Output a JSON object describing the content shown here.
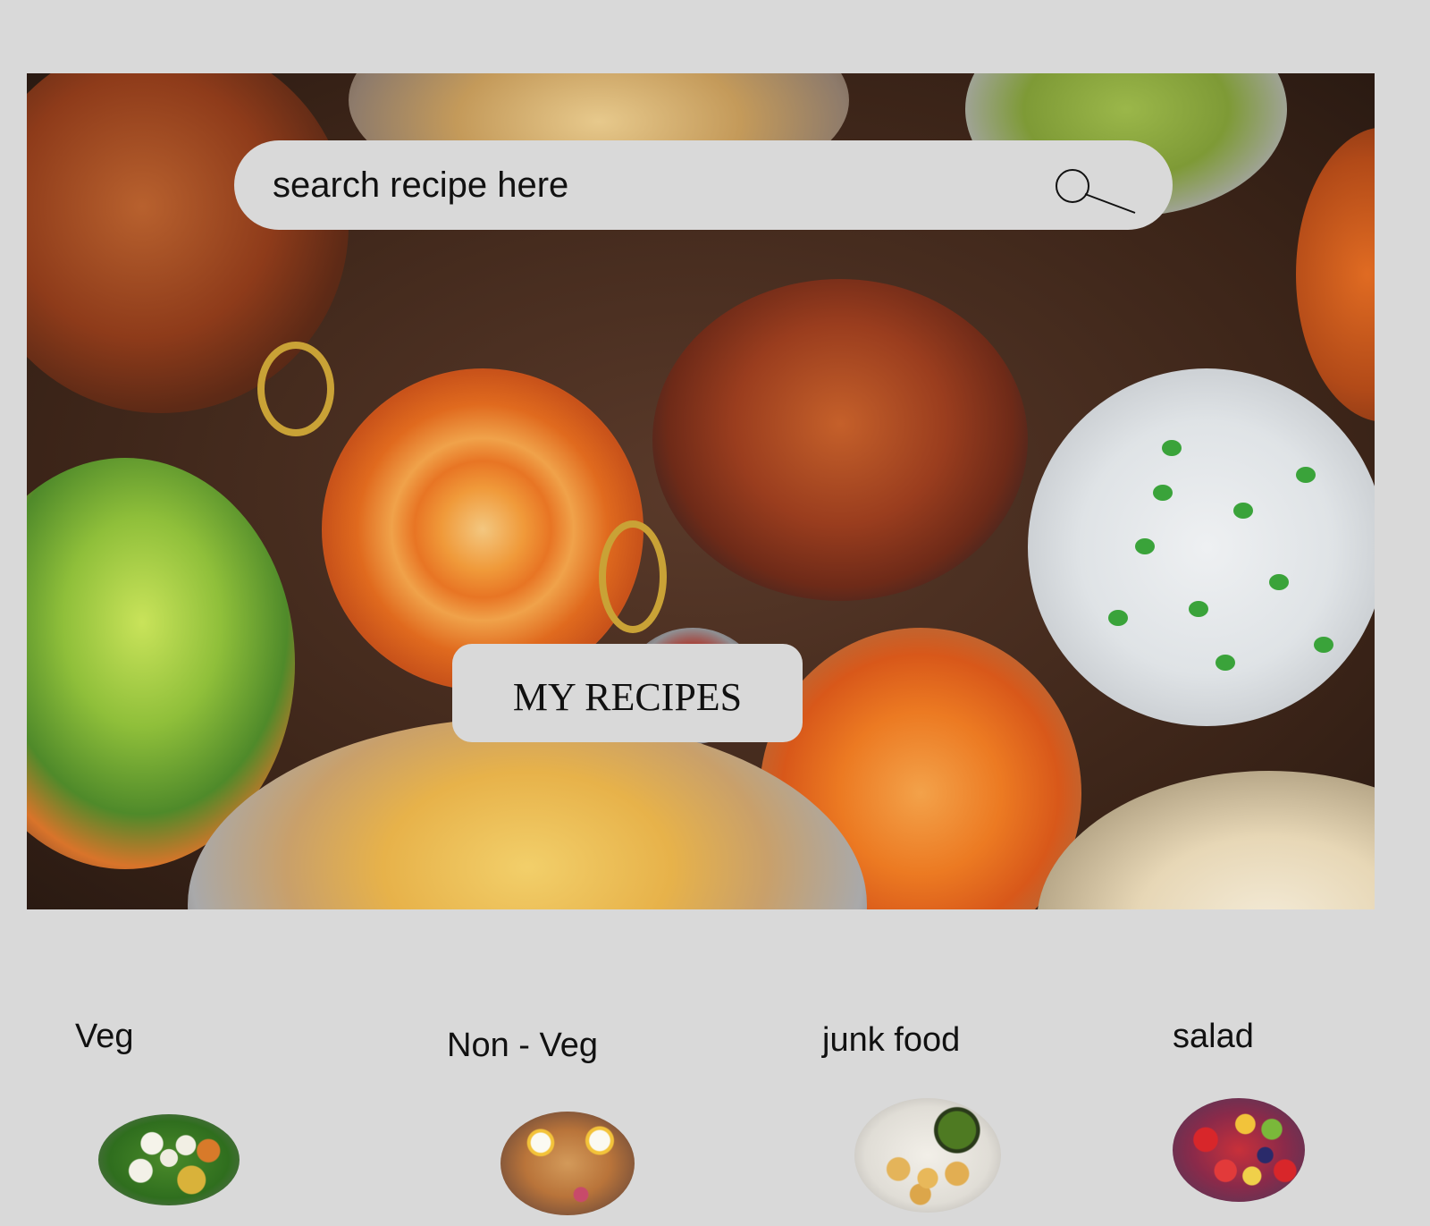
{
  "search": {
    "placeholder": "search recipe here"
  },
  "hero": {
    "image_alt": "assorted Indian dishes on a table",
    "button_label": "MY RECIPES"
  },
  "categories": [
    {
      "label": "Veg",
      "thumb_icon": "veg-food-photo"
    },
    {
      "label": "Non - Veg",
      "thumb_icon": "non-veg-food-photo"
    },
    {
      "label": "junk food",
      "thumb_icon": "junk-food-photo"
    },
    {
      "label": "salad",
      "thumb_icon": "salad-photo"
    }
  ],
  "colors": {
    "page_background": "#d9d9d9",
    "control_background": "#d9d9d9",
    "text": "#111111"
  }
}
